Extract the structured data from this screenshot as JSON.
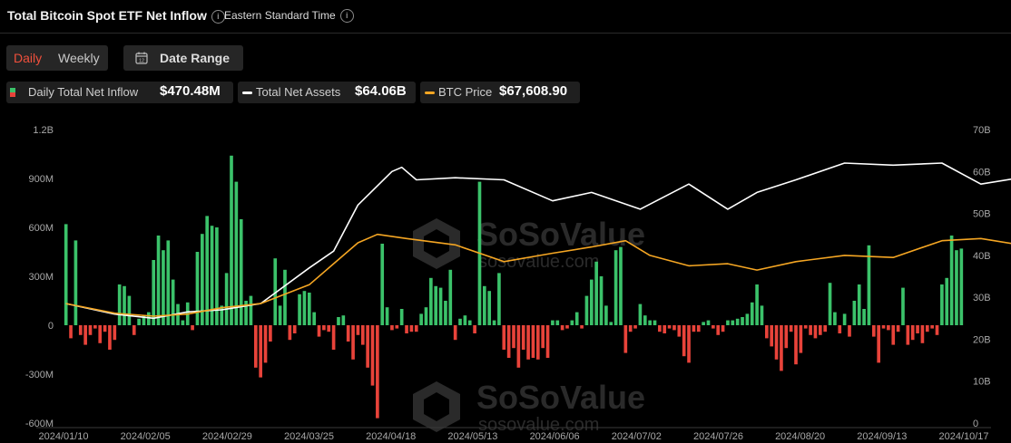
{
  "header": {
    "title": "Total Bitcoin Spot ETF Net Inflow",
    "timezone": "Eastern Standard Time"
  },
  "controls": {
    "daily_label": "Daily",
    "weekly_label": "Weekly",
    "date_range_label": "Date Range",
    "calendar_day": "12"
  },
  "legend": {
    "inflow_label": "Daily Total Net Inflow",
    "inflow_value": "$470.48M",
    "assets_label": "Total Net Assets",
    "assets_value": "$64.06B",
    "btc_label": "BTC Price",
    "btc_value": "$67,608.90"
  },
  "watermark": {
    "brand": "SoSoValue",
    "url": "sosovalue.com"
  },
  "colors": {
    "positive": "#3bc26a",
    "negative": "#e8433a",
    "assets_line": "#ffffff",
    "btc_line": "#f5a623",
    "accent": "#f0503c"
  },
  "chart_data": {
    "type": "bar",
    "x_tick_labels": [
      "2024/01/10",
      "2024/02/05",
      "2024/02/29",
      "2024/03/25",
      "2024/04/18",
      "2024/05/13",
      "2024/06/06",
      "2024/07/02",
      "2024/07/26",
      "2024/08/20",
      "2024/09/13",
      "2024/10/17"
    ],
    "y_left_ticks": [
      "1.2B",
      "900M",
      "600M",
      "300M",
      "0",
      "-300M",
      "-600M"
    ],
    "y_left_range": [
      -600,
      1200
    ],
    "y_left_unit": "M",
    "y_right_ticks": [
      "70B",
      "60B",
      "50B",
      "40B",
      "30B",
      "20B",
      "10B",
      "0"
    ],
    "y_right_range": [
      0,
      70
    ],
    "series": [
      {
        "name": "Daily Total Net Inflow",
        "kind": "bar",
        "values": [
          620,
          -80,
          520,
          -60,
          -120,
          -60,
          -20,
          -110,
          -40,
          -150,
          -90,
          250,
          240,
          180,
          -60,
          40,
          60,
          80,
          400,
          550,
          460,
          520,
          280,
          130,
          30,
          140,
          -30,
          450,
          560,
          670,
          610,
          600,
          120,
          320,
          1040,
          880,
          650,
          150,
          180,
          -260,
          -320,
          -230,
          -100,
          410,
          120,
          340,
          -90,
          -50,
          190,
          210,
          200,
          80,
          -70,
          -30,
          -40,
          -150,
          50,
          60,
          -100,
          -210,
          -60,
          -120,
          -260,
          -370,
          -570,
          500,
          110,
          -30,
          -20,
          100,
          -50,
          -40,
          -40,
          70,
          110,
          290,
          240,
          230,
          150,
          340,
          -90,
          40,
          60,
          30,
          -50,
          880,
          240,
          210,
          30,
          320,
          -150,
          -200,
          -140,
          -260,
          -150,
          -210,
          -200,
          -210,
          -140,
          -200,
          30,
          30,
          -30,
          -20,
          30,
          80,
          -20,
          180,
          280,
          390,
          300,
          120,
          20,
          460,
          480,
          -170,
          -40,
          -20,
          130,
          60,
          30,
          30,
          -40,
          -50,
          -20,
          -30,
          -70,
          -190,
          -230,
          -40,
          -40,
          20,
          30,
          -20,
          -60,
          -40,
          30,
          30,
          40,
          50,
          70,
          140,
          250,
          120,
          -80,
          -130,
          -210,
          -280,
          -140,
          -40,
          -240,
          -170,
          -20,
          -60,
          -80,
          -60,
          -40,
          260,
          80,
          -50,
          70,
          -70,
          150,
          250,
          100,
          490,
          -70,
          -230,
          -20,
          -30,
          -120,
          -40,
          230,
          -120,
          -90,
          -50,
          -110,
          -40,
          -20,
          -60,
          250,
          290,
          550,
          460,
          470
        ]
      },
      {
        "name": "Total Net Assets",
        "kind": "line",
        "axis": "right",
        "unit": "B",
        "values": [
          [
            0,
            28.5
          ],
          [
            10,
            26.0
          ],
          [
            18,
            25.0
          ],
          [
            25,
            26.5
          ],
          [
            32,
            27.0
          ],
          [
            40,
            28.5
          ],
          [
            50,
            37.0
          ],
          [
            55,
            41.0
          ],
          [
            60,
            52.0
          ],
          [
            67,
            60.0
          ],
          [
            69,
            61.0
          ],
          [
            72,
            58.0
          ],
          [
            80,
            58.5
          ],
          [
            90,
            58.0
          ],
          [
            100,
            53.0
          ],
          [
            108,
            55.0
          ],
          [
            118,
            51.0
          ],
          [
            128,
            57.0
          ],
          [
            136,
            51.0
          ],
          [
            142,
            55.0
          ],
          [
            150,
            58.0
          ],
          [
            160,
            62.0
          ],
          [
            170,
            61.5
          ],
          [
            180,
            62.0
          ],
          [
            188,
            57.0
          ],
          [
            196,
            58.5
          ],
          [
            205,
            55.0
          ],
          [
            210,
            57.0
          ],
          [
            215,
            51.0
          ],
          [
            225,
            60.0
          ],
          [
            235,
            62.0
          ],
          [
            242,
            52.0
          ],
          [
            252,
            59.0
          ],
          [
            262,
            57.0
          ],
          [
            270,
            58.5
          ],
          [
            280,
            54.0
          ],
          [
            287,
            58.0
          ],
          [
            295,
            55.0
          ],
          [
            300,
            60.0
          ],
          [
            310,
            57.0
          ],
          [
            320,
            55.0
          ],
          [
            330,
            58.0
          ],
          [
            338,
            61.0
          ],
          [
            345,
            62.0
          ],
          [
            355,
            58.0
          ],
          [
            360,
            56.0
          ],
          [
            367,
            61.0
          ],
          [
            373,
            64.0
          ],
          [
            380,
            64.5
          ],
          [
            381,
            64.06
          ]
        ]
      },
      {
        "name": "BTC Price",
        "kind": "line",
        "axis": "right",
        "unit": "B",
        "values": [
          [
            0,
            28.5
          ],
          [
            10,
            26.2
          ],
          [
            18,
            25.5
          ],
          [
            25,
            26.0
          ],
          [
            32,
            27.5
          ],
          [
            40,
            28.5
          ],
          [
            50,
            33.0
          ],
          [
            55,
            38.0
          ],
          [
            60,
            43.0
          ],
          [
            64,
            45.0
          ],
          [
            70,
            44.0
          ],
          [
            80,
            42.5
          ],
          [
            90,
            38.5
          ],
          [
            100,
            40.5
          ],
          [
            108,
            42.0
          ],
          [
            115,
            43.5
          ],
          [
            120,
            40.0
          ],
          [
            128,
            37.5
          ],
          [
            136,
            38.0
          ],
          [
            142,
            36.5
          ],
          [
            150,
            38.5
          ],
          [
            160,
            40.0
          ],
          [
            170,
            39.5
          ],
          [
            180,
            43.5
          ],
          [
            188,
            44.0
          ],
          [
            196,
            42.5
          ],
          [
            205,
            41.0
          ],
          [
            212,
            38.0
          ],
          [
            220,
            39.0
          ],
          [
            230,
            36.0
          ],
          [
            236,
            39.0
          ],
          [
            245,
            43.5
          ],
          [
            252,
            42.0
          ],
          [
            262,
            37.0
          ],
          [
            268,
            35.0
          ],
          [
            275,
            34.5
          ],
          [
            282,
            38.0
          ],
          [
            290,
            37.0
          ],
          [
            300,
            36.0
          ],
          [
            310,
            34.0
          ],
          [
            320,
            36.5
          ],
          [
            330,
            37.5
          ],
          [
            338,
            38.5
          ],
          [
            345,
            37.5
          ],
          [
            355,
            38.5
          ],
          [
            360,
            38.0
          ],
          [
            370,
            40.5
          ],
          [
            375,
            41.0
          ],
          [
            380,
            41.5
          ],
          [
            381,
            41.0
          ]
        ]
      }
    ],
    "grid": false,
    "legend_position": "top"
  }
}
